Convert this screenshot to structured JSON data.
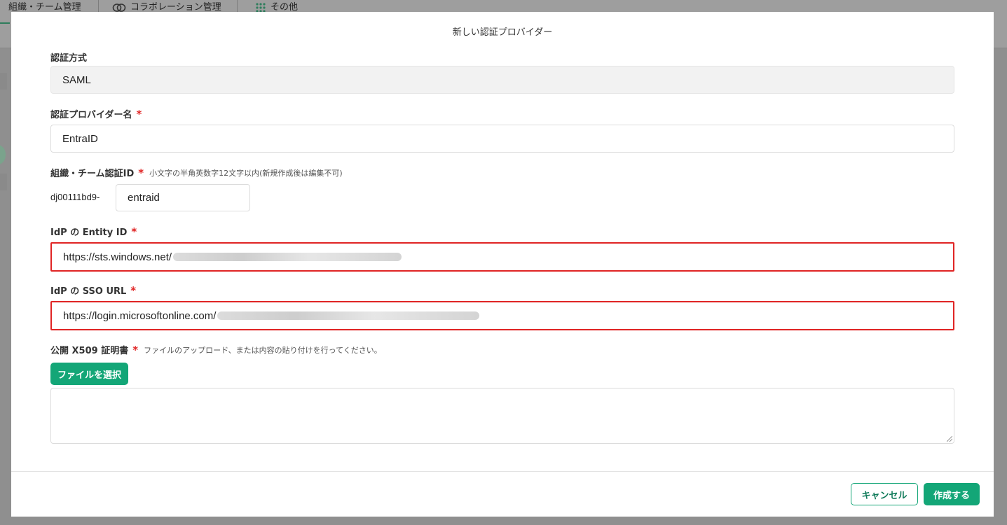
{
  "background_app": {
    "tabs": [
      {
        "icon": "team-icon",
        "label": "組織・チーム管理"
      },
      {
        "icon": "link-icon",
        "label": "コラボレーション管理"
      },
      {
        "icon": "grid-dots-icon",
        "label": "その他"
      }
    ]
  },
  "modal": {
    "title": "新しい認証プロバイダー",
    "auth_method": {
      "label": "認証方式",
      "value": "SAML"
    },
    "provider_name": {
      "label": "認証プロバイダー名",
      "required_mark": "*",
      "value": "EntraID"
    },
    "org_auth_id": {
      "label": "組織・チーム認証ID",
      "required_mark": "*",
      "hint": "小文字の半角英数字12文字以内(新規作成後は編集不可)",
      "prefix": "dj00111bd9-",
      "value": "entraid"
    },
    "entity_id": {
      "label": "IdP の Entity ID",
      "required_mark": "*",
      "value": "https://sts.windows.net/"
    },
    "sso_url": {
      "label": "IdP の SSO URL",
      "required_mark": "*",
      "value": "https://login.microsoftonline.com/"
    },
    "certificate": {
      "label": "公開 X509 証明書",
      "required_mark": "*",
      "hint": "ファイルのアップロード、または内容の貼り付けを行ってください。",
      "file_button": "ファイルを選択",
      "value": ""
    },
    "buttons": {
      "cancel": "キャンセル",
      "create": "作成する"
    },
    "colors": {
      "accent": "#13a677",
      "required": "#e02424",
      "highlight_border": "#e02424"
    }
  }
}
